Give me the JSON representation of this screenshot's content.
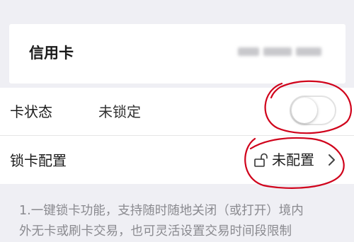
{
  "card": {
    "label": "信用卡"
  },
  "card_status": {
    "label": "卡状态",
    "value": "未锁定",
    "toggle_on": false
  },
  "lock_config": {
    "label": "锁卡配置",
    "value": "未配置"
  },
  "note": {
    "line1": "1.一键锁卡功能，支持随时随地关闭（或打开）境内",
    "line2": "外无卡或刷卡交易，也可灵活设置交易时间段限制"
  },
  "colors": {
    "background": "#efeff4",
    "panel": "#ffffff",
    "annotation": "#d0021b",
    "note_text": "#8a8a8f"
  },
  "icons": {
    "lock": "unlock-icon",
    "chevron": "chevron-right-icon"
  }
}
